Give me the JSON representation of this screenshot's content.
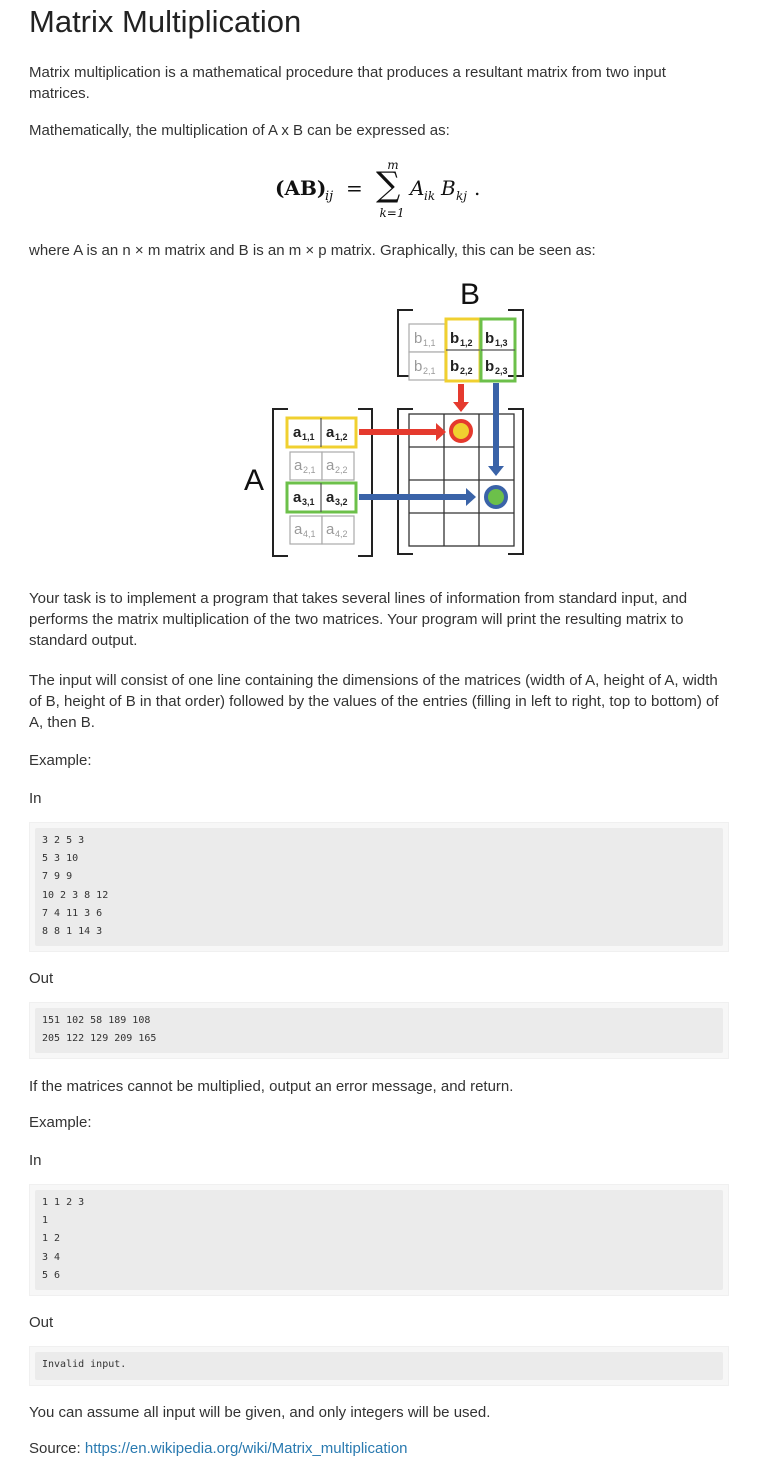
{
  "title": "Matrix Multiplication",
  "intro": "Matrix multiplication is a mathematical procedure that produces a resultant matrix from two input matrices.",
  "math_intro": "Mathematically, the multiplication of A x B can be expressed as:",
  "formula": {
    "lhs": "(AB)",
    "lhs_sub": "ij",
    "eq": "=",
    "sum_upper": "m",
    "sum_lower": "k=1",
    "term_a": "A",
    "term_a_sub": "ik",
    "term_b": "B",
    "term_b_sub": "kj",
    "period": "."
  },
  "where_text": "where A is an n × m matrix and B is an m × p matrix. Graphically, this can be seen as:",
  "diagram": {
    "label_a": "A",
    "label_b": "B",
    "a_cells": [
      [
        "a",
        "1,1",
        "a",
        "1,2"
      ],
      [
        "a",
        "2,1",
        "a",
        "2,2"
      ],
      [
        "a",
        "3,1",
        "a",
        "3,2"
      ],
      [
        "a",
        "4,1",
        "a",
        "4,2"
      ]
    ],
    "b_cells": [
      [
        "b",
        "1,1",
        "b",
        "1,2",
        "b",
        "1,3"
      ],
      [
        "b",
        "2,1",
        "b",
        "2,2",
        "b",
        "2,3"
      ]
    ],
    "colors": {
      "red": "#e53a2e",
      "blue": "#3a63a8",
      "yellow": "#f0d030",
      "green": "#6cc04a",
      "faded": "#9a9a9a"
    }
  },
  "task_text": "Your task is to implement a program that takes several lines of information from standard input, and performs the matrix multiplication of the two matrices. Your program will print the resulting matrix to standard output.",
  "input_text": "The input will consist of one line containing the dimensions of the matrices (width of A, height of A, width of B, height of B in that order) followed by the values of the entries (filling in left to right, top to bottom) of A, then B.",
  "example1": {
    "label": "Example:",
    "in_label": "In",
    "in_lines": [
      "3 2 5 3",
      "5 3 10",
      "7 9 9",
      "10 2 3 8 12",
      "7 4 11 3 6",
      "8 8 1 14 3"
    ],
    "out_label": "Out",
    "out_lines": [
      "151 102 58 189 108",
      "205 122 129 209 165"
    ]
  },
  "error_text": "If the matrices cannot be multiplied, output an error message, and return.",
  "example2": {
    "label": "Example:",
    "in_label": "In",
    "in_lines": [
      "1 1 2 3",
      "1",
      "1 2",
      "3 4",
      "5 6"
    ],
    "out_label": "Out",
    "out_lines": [
      "Invalid input."
    ]
  },
  "assume_text": "You can assume all input will be given, and only integers will be used.",
  "source_label": "Source: ",
  "source_url": "https://en.wikipedia.org/wiki/Matrix_multiplication"
}
